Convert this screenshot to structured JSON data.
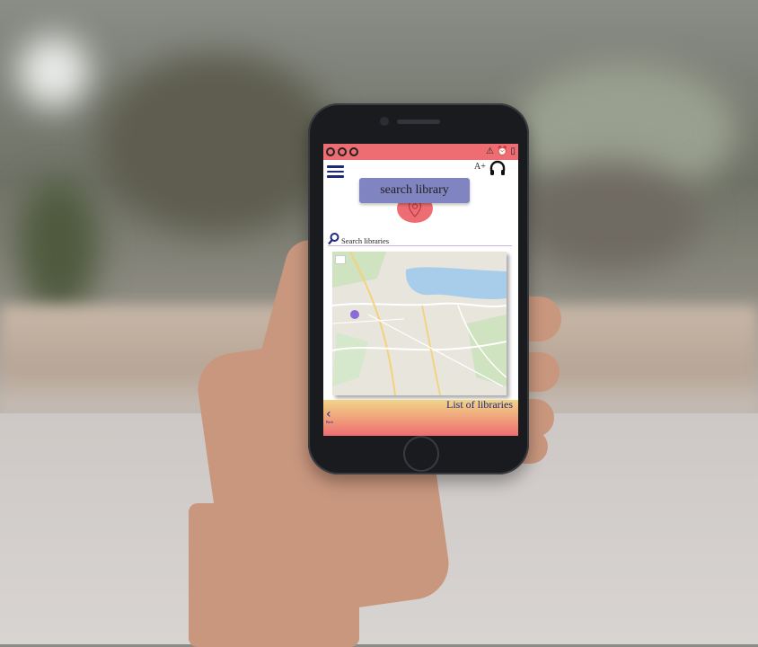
{
  "status_bar": {
    "left_icons": [
      "ring-icon",
      "ring-icon",
      "ring-icon"
    ],
    "right_icons": [
      "wifi-off-icon",
      "alarm-icon",
      "battery-charging-icon"
    ]
  },
  "header": {
    "font_size_label": "A+",
    "menu_icon": "hamburger-icon",
    "audio_icon": "headphone-icon"
  },
  "main": {
    "search_button_label": "search library",
    "search_placeholder": "Search libraries"
  },
  "map": {},
  "footer": {
    "list_label": "List of libraries",
    "back_label": "Back"
  },
  "colors": {
    "accent": "#ee6d72",
    "button": "#8084c0",
    "text_dark": "#1d2a7a"
  }
}
